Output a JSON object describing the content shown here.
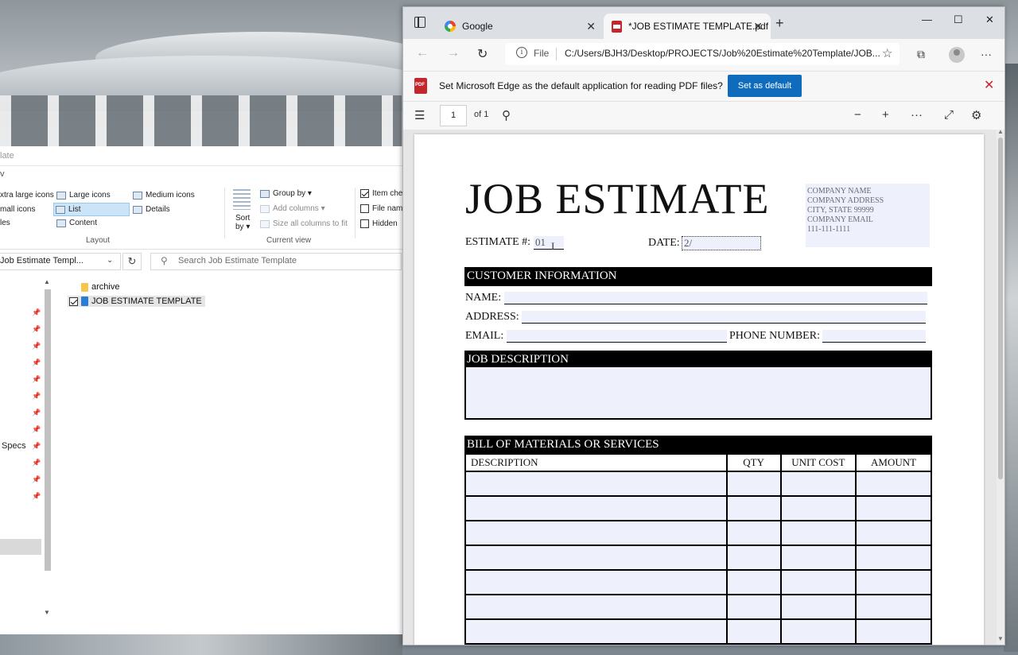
{
  "explorer": {
    "title_fragment": "late",
    "view_tab_fragment": "v",
    "ribbon": {
      "layout_options": [
        "xtra large icons",
        "Large icons",
        "Medium icons",
        "mall icons",
        "List",
        "Details",
        "les",
        "Content"
      ],
      "layout_group": "Layout",
      "sort_label": "Sort",
      "sort_by_label": "by ▾",
      "group_by": "Group by ▾",
      "add_columns": "Add columns ▾",
      "size_columns": "Size all columns to fit",
      "current_view_group": "Current view",
      "item_checkboxes": "Item che",
      "file_name_ext": "File nam",
      "hidden_items": "Hidden"
    },
    "address_path": "Job Estimate Templ...",
    "search_placeholder": "Search Job Estimate Template",
    "nav_specs": "Specs",
    "files": [
      {
        "name": "archive",
        "type": "folder"
      },
      {
        "name": "JOB ESTIMATE TEMPLATE",
        "type": "pdf",
        "checked": true
      }
    ]
  },
  "edge": {
    "tabs": [
      {
        "title": "Google",
        "icon": "google-icon"
      },
      {
        "title": "*JOB ESTIMATE TEMPLATE.pdf",
        "icon": "pdf-icon",
        "active": true
      }
    ],
    "url_scheme": "File",
    "url": "C:/Users/BJH3/Desktop/PROJECTS/Job%20Estimate%20Template/JOB...",
    "infobar_text": "Set Microsoft Edge as the default application for reading PDF files?",
    "infobar_button": "Set as default",
    "page_number": "1",
    "page_total": "of 1",
    "accent": "#0f6cbd"
  },
  "document": {
    "title": "JOB ESTIMATE",
    "company": [
      "COMPANY NAME",
      "COMPANY ADDRESS",
      "CITY, STATE 99999",
      "COMPANY EMAIL",
      "111-111-1111"
    ],
    "estimate_label": "ESTIMATE #:",
    "estimate_value": "01",
    "date_label": "DATE:",
    "date_value": "2/",
    "customer_header": "CUSTOMER INFORMATION",
    "name_label": "NAME:",
    "address_label": "ADDRESS:",
    "email_label": "EMAIL:",
    "phone_label": "PHONE NUMBER:",
    "job_header": "JOB DESCRIPTION",
    "bom_header": "BILL OF MATERIALS OR SERVICES",
    "bom_columns": [
      "DESCRIPTION",
      "QTY",
      "UNIT COST",
      "AMOUNT"
    ],
    "field_fill": "#eef0fb"
  }
}
